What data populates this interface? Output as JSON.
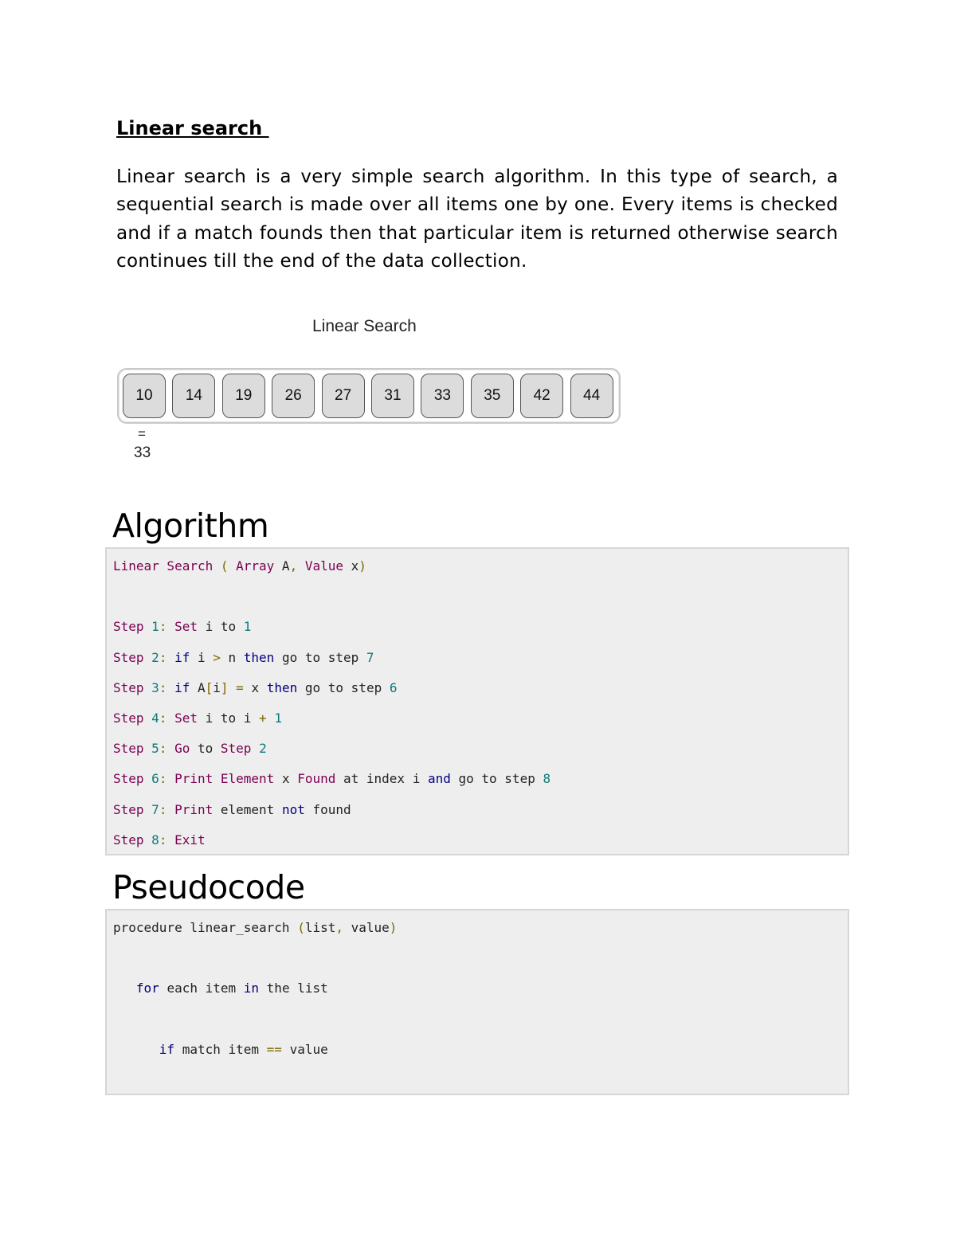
{
  "section": {
    "title": "Linear search ",
    "paragraph": "Linear search is a very simple search algorithm. In this type of search, a sequential search is made over all items one by one. Every items is checked and if a match founds then that particular item is returned otherwise search continues till the end of the data collection."
  },
  "figure": {
    "title": "Linear Search",
    "array": [
      "10",
      "14",
      "19",
      "26",
      "27",
      "31",
      "33",
      "35",
      "42",
      "44"
    ],
    "comparison_symbol": "=",
    "search_value": "33"
  },
  "algorithm": {
    "heading": "Algorithm",
    "lines": [
      [
        {
          "t": "Linear Search ",
          "c": "k"
        },
        {
          "t": "( ",
          "c": "p"
        },
        {
          "t": "Array ",
          "c": "k"
        },
        {
          "t": "A",
          "c": "t"
        },
        {
          "t": ", ",
          "c": "p"
        },
        {
          "t": "Value ",
          "c": "k"
        },
        {
          "t": "x",
          "c": "t"
        },
        {
          "t": ")",
          "c": "p"
        }
      ],
      [],
      [
        {
          "t": "Step ",
          "c": "k"
        },
        {
          "t": "1",
          "c": "n"
        },
        {
          "t": ": ",
          "c": "p"
        },
        {
          "t": "Set ",
          "c": "k"
        },
        {
          "t": "i to ",
          "c": "t"
        },
        {
          "t": "1",
          "c": "n"
        }
      ],
      [
        {
          "t": "Step ",
          "c": "k"
        },
        {
          "t": "2",
          "c": "n"
        },
        {
          "t": ": ",
          "c": "p"
        },
        {
          "t": "if ",
          "c": "b"
        },
        {
          "t": "i ",
          "c": "t"
        },
        {
          "t": "> ",
          "c": "p"
        },
        {
          "t": "n ",
          "c": "t"
        },
        {
          "t": "then ",
          "c": "b"
        },
        {
          "t": "go to step ",
          "c": "t"
        },
        {
          "t": "7",
          "c": "n"
        }
      ],
      [
        {
          "t": "Step ",
          "c": "k"
        },
        {
          "t": "3",
          "c": "n"
        },
        {
          "t": ": ",
          "c": "p"
        },
        {
          "t": "if ",
          "c": "b"
        },
        {
          "t": "A",
          "c": "t"
        },
        {
          "t": "[",
          "c": "p"
        },
        {
          "t": "i",
          "c": "t"
        },
        {
          "t": "] = ",
          "c": "p"
        },
        {
          "t": "x ",
          "c": "t"
        },
        {
          "t": "then ",
          "c": "b"
        },
        {
          "t": "go to step ",
          "c": "t"
        },
        {
          "t": "6",
          "c": "n"
        }
      ],
      [
        {
          "t": "Step ",
          "c": "k"
        },
        {
          "t": "4",
          "c": "n"
        },
        {
          "t": ": ",
          "c": "p"
        },
        {
          "t": "Set ",
          "c": "k"
        },
        {
          "t": "i to i ",
          "c": "t"
        },
        {
          "t": "+ ",
          "c": "p"
        },
        {
          "t": "1",
          "c": "n"
        }
      ],
      [
        {
          "t": "Step ",
          "c": "k"
        },
        {
          "t": "5",
          "c": "n"
        },
        {
          "t": ": ",
          "c": "p"
        },
        {
          "t": "Go ",
          "c": "k"
        },
        {
          "t": "to ",
          "c": "t"
        },
        {
          "t": "Step ",
          "c": "k"
        },
        {
          "t": "2",
          "c": "n"
        }
      ],
      [
        {
          "t": "Step ",
          "c": "k"
        },
        {
          "t": "6",
          "c": "n"
        },
        {
          "t": ": ",
          "c": "p"
        },
        {
          "t": "Print Element ",
          "c": "k"
        },
        {
          "t": "x ",
          "c": "t"
        },
        {
          "t": "Found ",
          "c": "k"
        },
        {
          "t": "at index i ",
          "c": "t"
        },
        {
          "t": "and ",
          "c": "b"
        },
        {
          "t": "go to step ",
          "c": "t"
        },
        {
          "t": "8",
          "c": "n"
        }
      ],
      [
        {
          "t": "Step ",
          "c": "k"
        },
        {
          "t": "7",
          "c": "n"
        },
        {
          "t": ": ",
          "c": "p"
        },
        {
          "t": "Print ",
          "c": "k"
        },
        {
          "t": "element ",
          "c": "t"
        },
        {
          "t": "not ",
          "c": "b"
        },
        {
          "t": "found",
          "c": "t"
        }
      ],
      [
        {
          "t": "Step ",
          "c": "k"
        },
        {
          "t": "8",
          "c": "n"
        },
        {
          "t": ": ",
          "c": "p"
        },
        {
          "t": "Exit",
          "c": "k"
        }
      ]
    ]
  },
  "pseudocode": {
    "heading": "Pseudocode",
    "lines": [
      [
        {
          "t": "procedure linear_search ",
          "c": "t"
        },
        {
          "t": "(",
          "c": "p"
        },
        {
          "t": "list",
          "c": "t"
        },
        {
          "t": ", ",
          "c": "p"
        },
        {
          "t": "value",
          "c": "t"
        },
        {
          "t": ")",
          "c": "p"
        }
      ],
      [],
      [
        {
          "t": "   ",
          "c": "t"
        },
        {
          "t": "for ",
          "c": "b"
        },
        {
          "t": "each item ",
          "c": "t"
        },
        {
          "t": "in ",
          "c": "b"
        },
        {
          "t": "the list",
          "c": "t"
        }
      ],
      [],
      [
        {
          "t": "      ",
          "c": "t"
        },
        {
          "t": "if ",
          "c": "b"
        },
        {
          "t": "match item ",
          "c": "t"
        },
        {
          "t": "== ",
          "c": "p"
        },
        {
          "t": "value",
          "c": "t"
        }
      ]
    ]
  }
}
